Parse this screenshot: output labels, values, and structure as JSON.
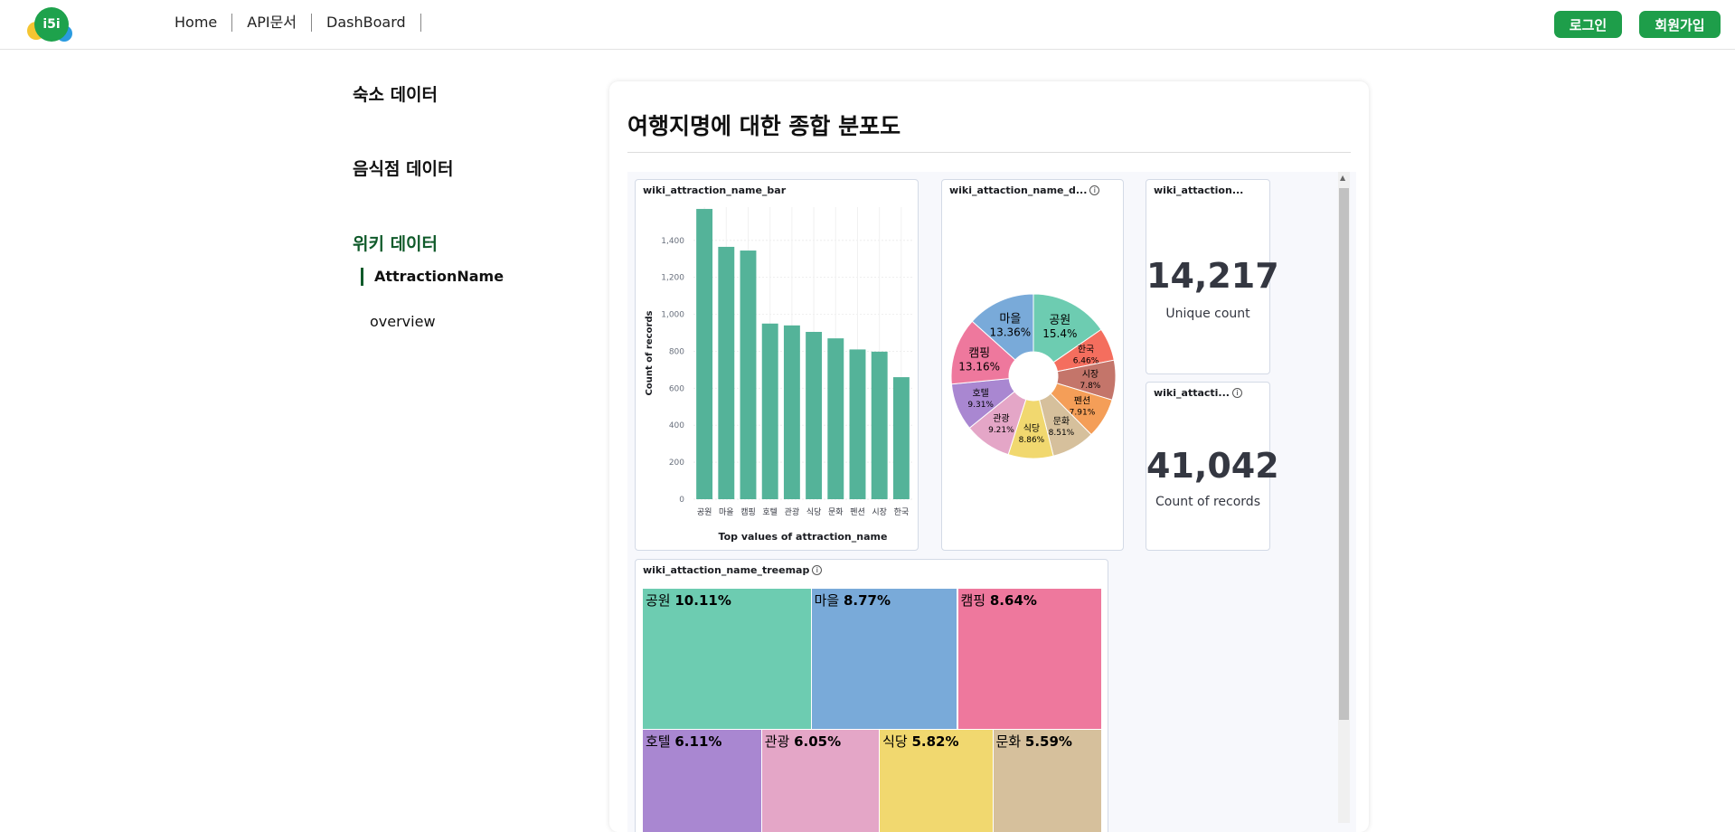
{
  "header": {
    "logo_text": "i5i",
    "nav": [
      "Home",
      "API문서",
      "DashBoard"
    ],
    "login_label": "로그인",
    "signup_label": "회원가입"
  },
  "sidebar": {
    "sections": [
      {
        "label": "숙소 데이터"
      },
      {
        "label": "음식점 데이터"
      },
      {
        "label": "위키 데이터",
        "items": [
          "AttractionName",
          "overview"
        ]
      }
    ]
  },
  "main": {
    "title": "여행지명에 대한 종합 분포도"
  },
  "panels": {
    "bar": {
      "title": "wiki_attraction_name_bar"
    },
    "donut": {
      "title": "wiki_attaction_name_d..."
    },
    "metric1": {
      "title": "wiki_attaction...",
      "value": "14,217",
      "label": "Unique count"
    },
    "metric2": {
      "title": "wiki_attacti...",
      "value": "41,042",
      "label": "Count of records"
    },
    "treemap": {
      "title": "wiki_attaction_name_treemap"
    }
  },
  "chart_data": [
    {
      "type": "bar",
      "title": "wiki_attraction_name_bar",
      "categories": [
        "공원",
        "마을",
        "캠핑",
        "호텔",
        "관광",
        "식당",
        "문화",
        "펜션",
        "시장",
        "한국"
      ],
      "values": [
        1570,
        1365,
        1345,
        950,
        940,
        905,
        870,
        810,
        798,
        660
      ],
      "xlabel": "Top values of attraction_name",
      "ylabel": "Count of records",
      "yticks": [
        0,
        200,
        400,
        600,
        800,
        1000,
        1200,
        1400
      ],
      "ytick_labels": [
        "0",
        "200",
        "400",
        "600",
        "800",
        "1,000",
        "1,200",
        "1,400"
      ],
      "ylim": [
        0,
        1580
      ],
      "color": "#54b399"
    },
    {
      "type": "pie",
      "title": "wiki_attaction_name_d...",
      "slices": [
        {
          "label": "공원",
          "pct": "15.4%",
          "value": 15.4,
          "color": "#6dccb1"
        },
        {
          "label": "한국",
          "pct": "6.46%",
          "value": 6.46,
          "color": "#f46e5e"
        },
        {
          "label": "시장",
          "pct": "7.8%",
          "value": 7.8,
          "color": "#c4756a"
        },
        {
          "label": "펜션",
          "pct": "7.91%",
          "value": 7.91,
          "color": "#f49e58"
        },
        {
          "label": "문화",
          "pct": "8.51%",
          "value": 8.51,
          "color": "#d6c09c"
        },
        {
          "label": "식당",
          "pct": "8.86%",
          "value": 8.86,
          "color": "#f1d86f"
        },
        {
          "label": "관광",
          "pct": "9.21%",
          "value": 9.21,
          "color": "#e4a6c7"
        },
        {
          "label": "호텔",
          "pct": "9.31%",
          "value": 9.31,
          "color": "#a987d1"
        },
        {
          "label": "캠핑",
          "pct": "13.16%",
          "value": 13.16,
          "color": "#ee789d"
        },
        {
          "label": "마을",
          "pct": "13.36%",
          "value": 13.36,
          "color": "#79aad9"
        }
      ]
    },
    {
      "type": "heatmap",
      "title": "wiki_attaction_name_treemap",
      "cells": [
        {
          "label": "공원",
          "pct": "10.11%",
          "color": "#6dccb1"
        },
        {
          "label": "마을",
          "pct": "8.77%",
          "color": "#79aad9"
        },
        {
          "label": "캠핑",
          "pct": "8.64%",
          "color": "#ee789d"
        },
        {
          "label": "호텔",
          "pct": "6.11%",
          "color": "#a987d1"
        },
        {
          "label": "관광",
          "pct": "6.05%",
          "color": "#e4a6c7"
        },
        {
          "label": "식당",
          "pct": "5.82%",
          "color": "#f1d86f"
        },
        {
          "label": "문화",
          "pct": "5.59%",
          "color": "#d6c09c"
        }
      ]
    }
  ]
}
